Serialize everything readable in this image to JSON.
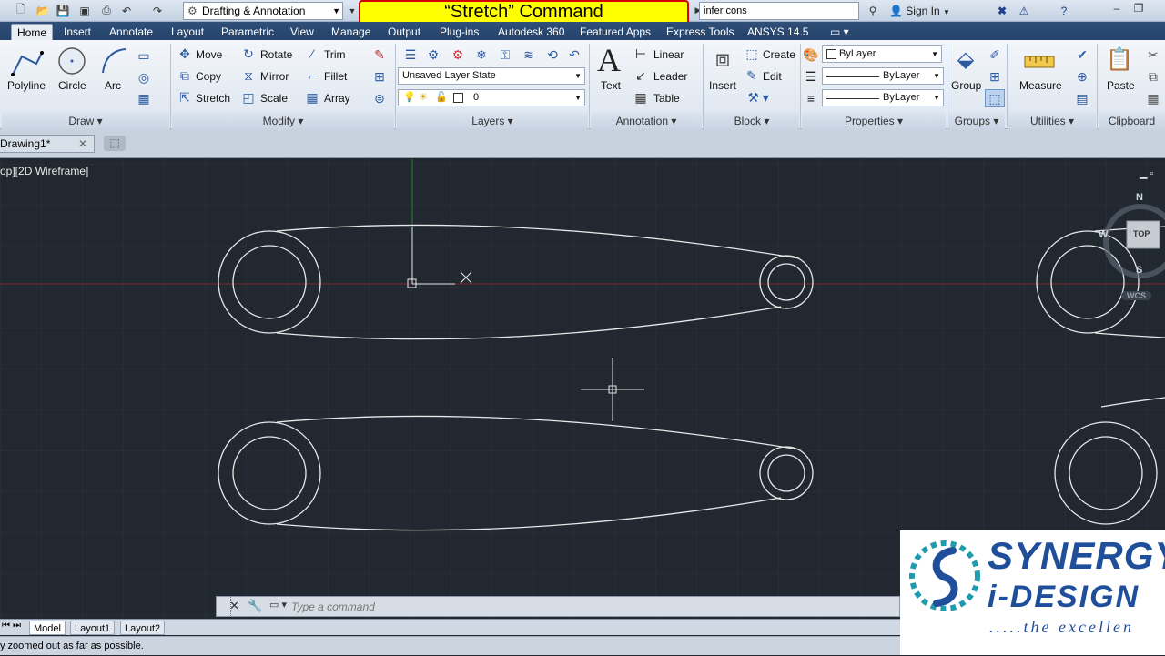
{
  "title_bar": {
    "workspace": "Drafting & Annotation",
    "banner": "“Stretch” Command",
    "search_value": "infer cons",
    "sign_in": "Sign In"
  },
  "tabs": [
    "Home",
    "Insert",
    "Annotate",
    "Layout",
    "Parametric",
    "View",
    "Manage",
    "Output",
    "Plug-ins",
    "Autodesk 360",
    "Featured Apps",
    "Express Tools",
    "ANSYS 14.5"
  ],
  "ribbon": {
    "draw": {
      "title": "Draw",
      "polyline": "Polyline",
      "circle": "Circle",
      "arc": "Arc"
    },
    "modify": {
      "title": "Modify",
      "move": "Move",
      "rotate": "Rotate",
      "trim": "Trim",
      "copy": "Copy",
      "mirror": "Mirror",
      "fillet": "Fillet",
      "stretch": "Stretch",
      "scale": "Scale",
      "array": "Array"
    },
    "layers": {
      "title": "Layers",
      "layer_state": "Unsaved Layer State",
      "current_layer": "0"
    },
    "annotation": {
      "title": "Annotation",
      "text": "Text",
      "linear": "Linear",
      "leader": "Leader",
      "table": "Table"
    },
    "block": {
      "title": "Block",
      "insert": "Insert",
      "create": "Create",
      "edit": "Edit"
    },
    "properties": {
      "title": "Properties",
      "color": "ByLayer",
      "linetype": "ByLayer",
      "lineweight": "ByLayer"
    },
    "groups": {
      "title": "Groups",
      "group": "Group"
    },
    "utilities": {
      "title": "Utilities",
      "measure": "Measure"
    },
    "clipboard": {
      "title": "Clipboard",
      "paste": "Paste"
    }
  },
  "file_tab": "Drawing1*",
  "viewport_label": "op][2D Wireframe]",
  "viewcube": {
    "north": "N",
    "west": "W",
    "top": "TOP",
    "south": "S",
    "wcs": "WCS"
  },
  "command_line": {
    "placeholder": "Type a command"
  },
  "layout_tabs": [
    "Model",
    "Layout1",
    "Layout2"
  ],
  "status_message": "y zoomed out as far as possible.",
  "logo": {
    "line1": "SYNERGY",
    "line2": "i-DESIGN",
    "line3": ".....the excellen"
  },
  "colors": {
    "canvas": "#212830",
    "banner": "#ffff00",
    "banner_border": "#d40000",
    "ribbon_tabs": "#2f4f79",
    "logo_blue": "#1f4e9a"
  }
}
